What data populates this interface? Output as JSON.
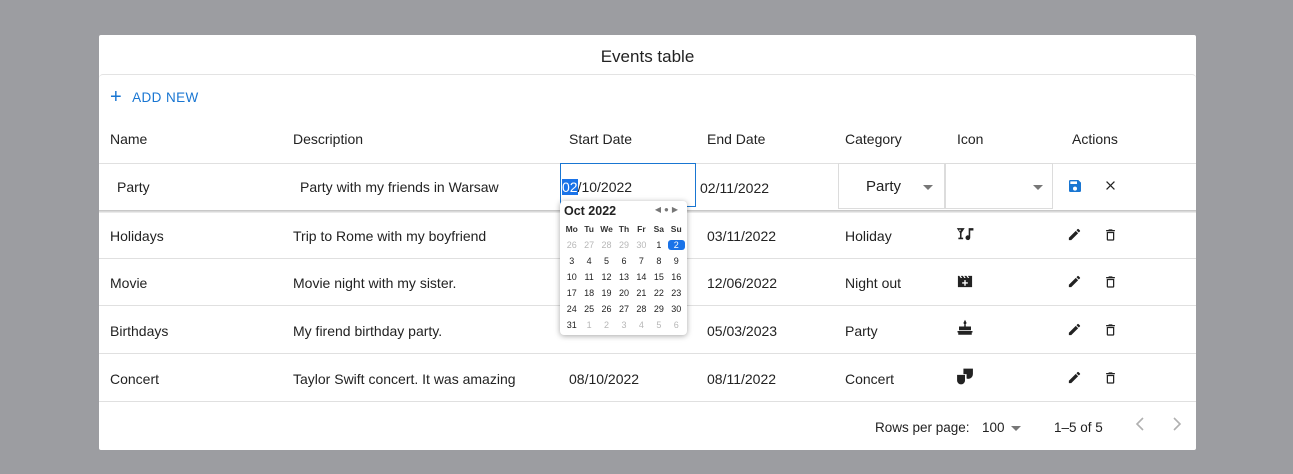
{
  "title": "Events table",
  "toolbar": {
    "add_new_label": "ADD NEW"
  },
  "columns": [
    "Name",
    "Description",
    "Start Date",
    "End Date",
    "Category",
    "Icon",
    "Actions"
  ],
  "editing_row": {
    "name": "Party",
    "description": "Party with my friends in Warsaw",
    "start_date_highlight": "02",
    "start_date_rest": "/10/2022",
    "end_date": "02/11/2022",
    "category": "Party",
    "icon": ""
  },
  "rows": [
    {
      "name": "Holidays",
      "description": "Trip to Rome with my boyfriend",
      "start_date": "",
      "end_date": "03/11/2022",
      "category": "Holiday",
      "icon": "cocktail-music-icon"
    },
    {
      "name": "Movie",
      "description": "Movie night with my sister.",
      "start_date": "",
      "end_date": "12/06/2022",
      "category": "Night out",
      "icon": "movie-clapper-icon"
    },
    {
      "name": "Birthdays",
      "description": "My firend birthday party.",
      "start_date": "",
      "end_date": "05/03/2023",
      "category": "Party",
      "icon": "cake-icon"
    },
    {
      "name": "Concert",
      "description": "Taylor Swift concert. It was amazing",
      "start_date": "08/10/2022",
      "end_date": "08/11/2022",
      "category": "Concert",
      "icon": "theater-masks-icon"
    }
  ],
  "calendar": {
    "month_label": "Oct 2022",
    "weekdays": [
      "Mo",
      "Tu",
      "We",
      "Th",
      "Fr",
      "Sa",
      "Su"
    ],
    "weeks": [
      [
        "26",
        "27",
        "28",
        "29",
        "30",
        "1",
        "2"
      ],
      [
        "3",
        "4",
        "5",
        "6",
        "7",
        "8",
        "9"
      ],
      [
        "10",
        "11",
        "12",
        "13",
        "14",
        "15",
        "16"
      ],
      [
        "17",
        "18",
        "19",
        "20",
        "21",
        "22",
        "23"
      ],
      [
        "24",
        "25",
        "26",
        "27",
        "28",
        "29",
        "30"
      ],
      [
        "31",
        "1",
        "2",
        "3",
        "4",
        "5",
        "6"
      ]
    ],
    "selected": "2"
  },
  "footer": {
    "rows_per_page_label": "Rows per page:",
    "rows_per_page_value": "100",
    "range_label": "1–5 of 5"
  },
  "colors": {
    "accent": "#1976d2",
    "background": "#9c9da1",
    "selected_day": "#1a73e8"
  }
}
